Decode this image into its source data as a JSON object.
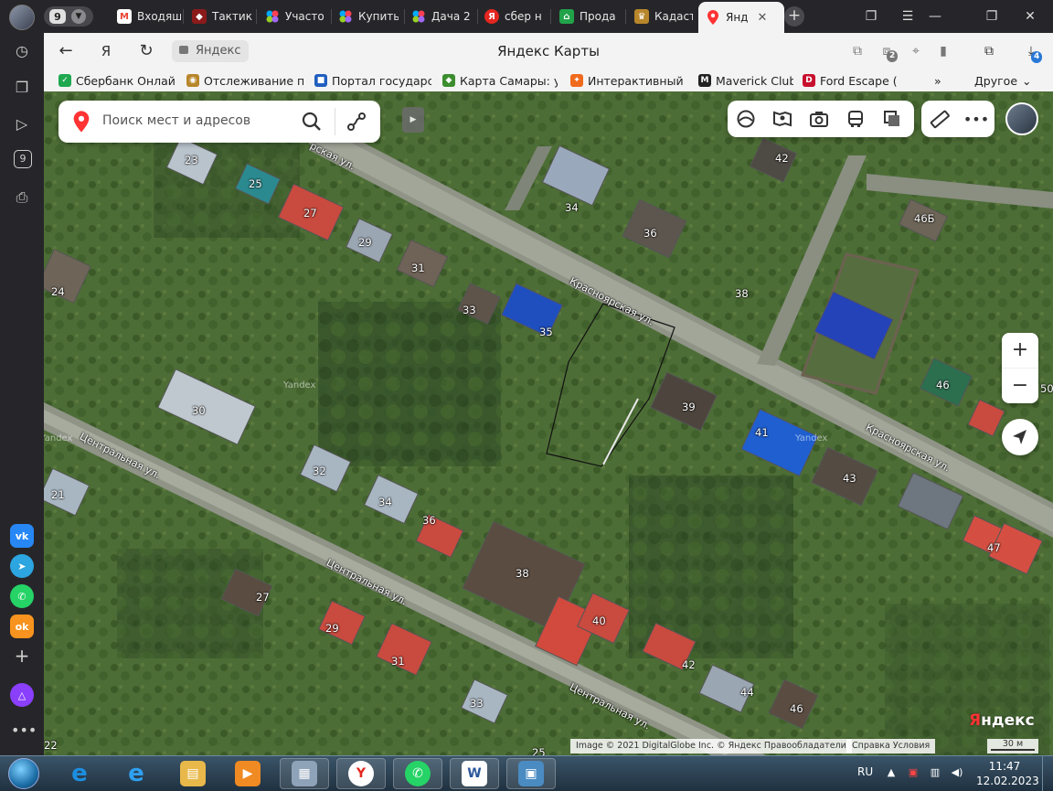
{
  "browser": {
    "tab_count": "9",
    "tabs": [
      {
        "label": "Входящ",
        "icon": "gmail-icon",
        "color": "#ea4335"
      },
      {
        "label": "Тактик",
        "icon": "app-icon",
        "color": "#8b1a1a"
      },
      {
        "label": "Участо",
        "icon": "ads-icon",
        "color": "#1fa84f"
      },
      {
        "label": "Купить",
        "icon": "ads-icon",
        "color": "#1fa84f"
      },
      {
        "label": "Дача 2",
        "icon": "ads-icon",
        "color": "#1fa84f"
      },
      {
        "label": "сбер н",
        "icon": "yandex-icon",
        "color": "#e52620"
      },
      {
        "label": "Прода",
        "icon": "domclick-icon",
        "color": "#22a34a"
      },
      {
        "label": "Кадаст",
        "icon": "emblem-icon",
        "color": "#b8862b"
      }
    ],
    "active_tab": {
      "label": "Янд",
      "icon": "map-pin-icon",
      "color": "#f33"
    },
    "page_title": "Яндекс Карты",
    "domain": "Яндекс",
    "downloads_badge": "4",
    "extension_badge": "2"
  },
  "bookmarks": [
    {
      "label": "Сбербанк Онлайн",
      "color": "#1fa84f",
      "glyph": "✓"
    },
    {
      "label": "Отслеживание по",
      "color": "#b8862b",
      "glyph": "◉"
    },
    {
      "label": "Портал государств",
      "color": "#1f5fbf",
      "glyph": "■"
    },
    {
      "label": "Карта Самары: ули",
      "color": "#3c8d2f",
      "glyph": "◆"
    },
    {
      "label": "Интерактивный п",
      "color": "#f06a1e",
      "glyph": "✦"
    },
    {
      "label": "Maverick Club",
      "color": "#222222",
      "glyph": "M"
    },
    {
      "label": "Ford Escape (1",
      "color": "#c8102e",
      "glyph": "D"
    }
  ],
  "bookmarks_more": "»",
  "bookmarks_other": "Другое",
  "map": {
    "search_placeholder": "Поиск мест и адресов",
    "attribution": "Image © 2021 DigitalGlobe Inc. © Яндекс   Правообладатели",
    "links": "Справка   Условия",
    "scale": "30 м",
    "logo_prefix": "Я",
    "logo_rest": "ндекс",
    "watermarks": [
      "Yandex",
      "Yandex",
      "Yandex"
    ],
    "streets": {
      "krasnoyarskaya_top": "рская ул.",
      "krasnoyarskaya_mid": "Красноярская ул.",
      "krasnoyarskaya_right": "Красноярская ул.",
      "tsentralnaya_left": "Центральная ул.",
      "tsentralnaya_mid": "Центральная ул.",
      "tsentralnaya_bottom": "Центральная ул."
    },
    "house_numbers": [
      "23",
      "25",
      "27",
      "29",
      "31",
      "33",
      "35",
      "34",
      "36",
      "42",
      "46Б",
      "38",
      "24",
      "30",
      "39",
      "41",
      "46",
      "43",
      "50",
      "32",
      "21",
      "34",
      "36",
      "38",
      "40",
      "42",
      "44",
      "46",
      "47",
      "27",
      "29",
      "31",
      "33",
      "22",
      "25"
    ]
  },
  "taskbar": {
    "lang": "RU",
    "time": "11:47",
    "date": "12.02.2023"
  }
}
